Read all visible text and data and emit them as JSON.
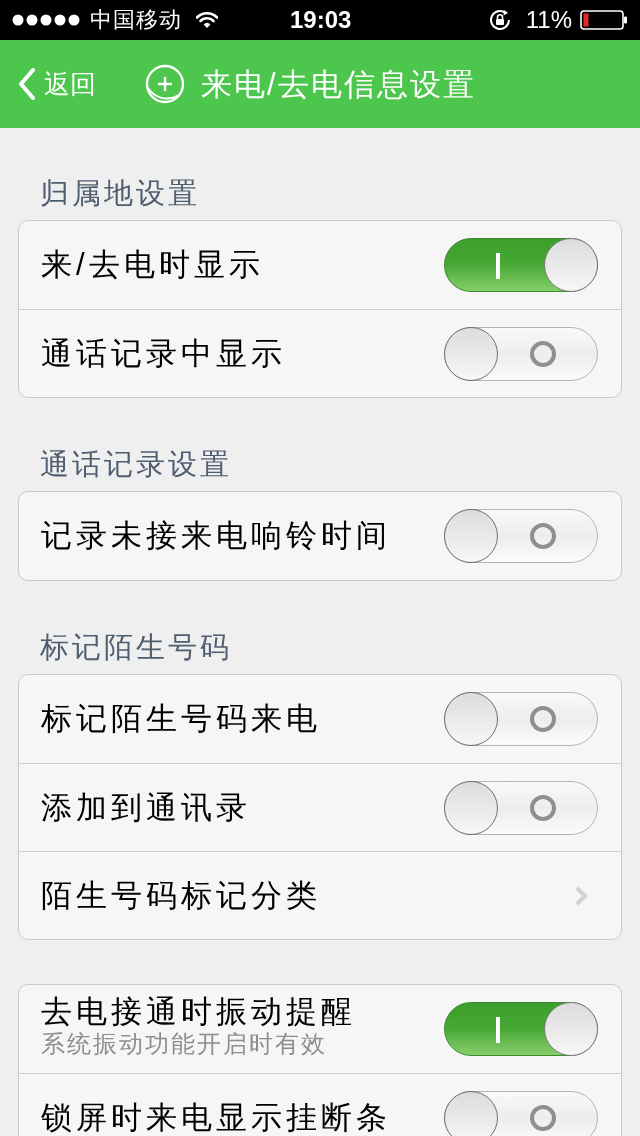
{
  "status_bar": {
    "carrier": "中国移动",
    "time": "19:03",
    "battery": "11%"
  },
  "nav_bar": {
    "back": "返回",
    "title": "来电/去电信息设置"
  },
  "sections": [
    {
      "header": "归属地设置",
      "rows": [
        {
          "kind": "toggle",
          "label": "来/去电时显示",
          "on": true
        },
        {
          "kind": "toggle",
          "label": "通话记录中显示",
          "on": false
        }
      ]
    },
    {
      "header": "通话记录设置",
      "rows": [
        {
          "kind": "toggle",
          "label": "记录未接来电响铃时间",
          "on": false
        }
      ]
    },
    {
      "header": "标记陌生号码",
      "rows": [
        {
          "kind": "toggle",
          "label": "标记陌生号码来电",
          "on": false
        },
        {
          "kind": "toggle",
          "label": "添加到通讯录",
          "on": false
        },
        {
          "kind": "link",
          "label": "陌生号码标记分类"
        }
      ]
    },
    {
      "rows": [
        {
          "kind": "toggle",
          "label": "去电接通时振动提醒",
          "subtitle": "系统振动功能开启时有效",
          "on": true
        },
        {
          "kind": "toggle",
          "label": "锁屏时来电显示挂断条",
          "on": false
        }
      ]
    }
  ]
}
